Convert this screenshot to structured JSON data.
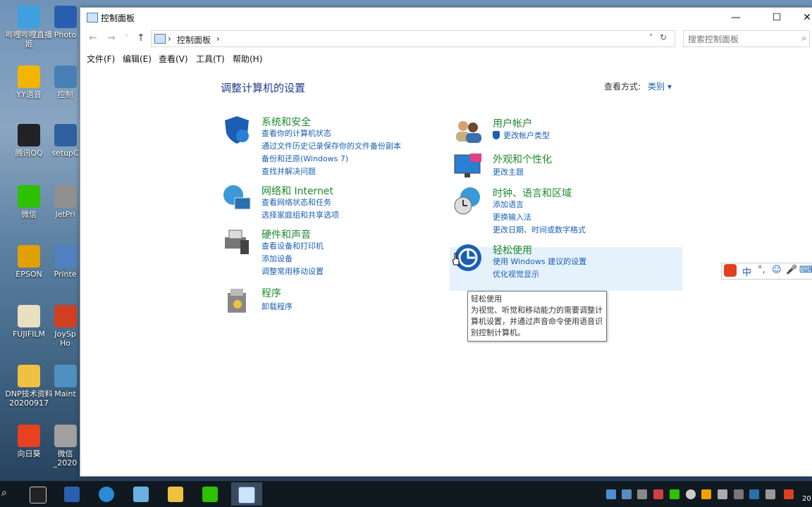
{
  "desktop": {
    "icons": [
      {
        "label": "哔哩哔哩直播姬",
        "color": "#3fa0e0"
      },
      {
        "label": "YY语音",
        "color": "#f2b600"
      },
      {
        "label": "腾讯QQ",
        "color": "#222222"
      },
      {
        "label": "微信",
        "color": "#2dc100"
      },
      {
        "label": "EPSON",
        "color": "#e0a000"
      },
      {
        "label": "FUJIFILM",
        "color": "#e8e0c0"
      },
      {
        "label": "DNP技术资料20200917",
        "color": "#f0c040"
      },
      {
        "label": "向日葵",
        "color": "#e84020"
      }
    ],
    "icons2": [
      {
        "label": "Photo",
        "color": "#2a5fb0"
      },
      {
        "label": "控制",
        "color": "#4a7fb5"
      },
      {
        "label": "setupC",
        "color": "#3060a0"
      },
      {
        "label": "JetPri",
        "color": "#909090"
      },
      {
        "label": "Printe",
        "color": "#5080c0"
      },
      {
        "label": "JoySp Ho",
        "color": "#d04020"
      },
      {
        "label": "Maint",
        "color": "#5090c0"
      },
      {
        "label": "微信 _2020",
        "color": "#a0a0a0"
      }
    ]
  },
  "window": {
    "title": "控制面板",
    "controls": {
      "minimize": "—",
      "maximize": "☐",
      "close": "✕"
    },
    "address": {
      "crumb": "控制面板",
      "sep": "›"
    },
    "search_placeholder": "搜索控制面板",
    "menu": [
      "文件(F)",
      "编辑(E)",
      "查看(V)",
      "工具(T)",
      "帮助(H)"
    ]
  },
  "content": {
    "heading": "调整计算机的设置",
    "view_by_label": "查看方式:",
    "view_by_value": "类别 ▾",
    "left": [
      {
        "title": "系统和安全",
        "links": [
          "查看你的计算机状态",
          "通过文件历史记录保存你的文件备份副本",
          "备份和还原(Windows 7)",
          "查找并解决问题"
        ]
      },
      {
        "title": "网络和 Internet",
        "links": [
          "查看网络状态和任务",
          "选择家庭组和共享选项"
        ]
      },
      {
        "title": "硬件和声音",
        "links": [
          "查看设备和打印机",
          "添加设备",
          "调整常用移动设置"
        ]
      },
      {
        "title": "程序",
        "links": [
          "卸载程序"
        ]
      }
    ],
    "right": [
      {
        "title": "用户帐户",
        "links": [
          "更改帐户类型"
        ]
      },
      {
        "title": "外观和个性化",
        "links": [
          "更改主题"
        ]
      },
      {
        "title": "时钟、语言和区域",
        "links": [
          "添加语言",
          "更换输入法",
          "更改日期、时间或数字格式"
        ]
      },
      {
        "title": "轻松使用",
        "links": [
          "使用 Windows 建议的设置",
          "优化视觉显示"
        ]
      }
    ],
    "tooltip": {
      "title": "轻松使用",
      "body": "为视觉、听觉和移动能力的需要调整计算机设置，并通过声音命令使用语音识别控制计算机。"
    }
  },
  "ime": {
    "items": [
      "中",
      "°,",
      "☺",
      "🎤",
      "⌨"
    ]
  },
  "taskbar": {
    "clock": "20"
  }
}
